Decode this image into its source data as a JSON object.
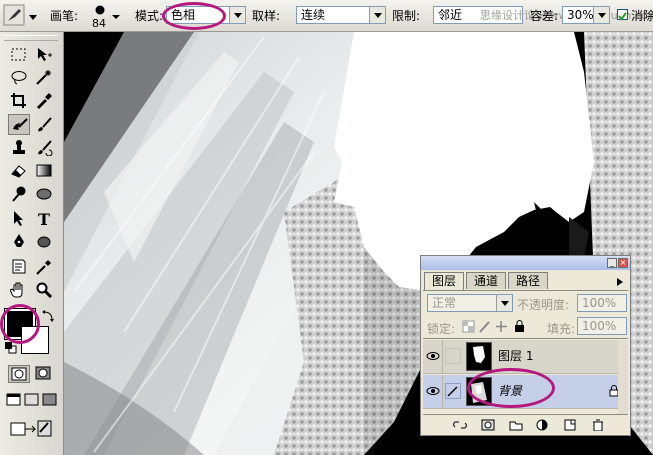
{
  "options_bar": {
    "brush_label": "画笔:",
    "brush_size": "84",
    "mode_label": "模式:",
    "mode_value": "色相",
    "sampling_label": "取样:",
    "sampling_value": "连续",
    "limits_label": "限制:",
    "limits_value": "邻近",
    "overlap_text": "思缘设计论坛  www.missyuan.com",
    "tolerance_label": "容差:",
    "tolerance_value": "30%",
    "antialias_label": "消除"
  },
  "toolbox": {
    "tools": [
      "marquee",
      "move",
      "lasso",
      "magic-wand",
      "crop",
      "slice",
      "healing",
      "brush",
      "stamp",
      "history-brush",
      "eraser",
      "gradient",
      "dodge",
      "blur",
      "path-select",
      "type",
      "pen",
      "shape",
      "notes",
      "eyedropper",
      "hand",
      "zoom"
    ],
    "foreground_color": "#000000",
    "background_color": "#ffffff"
  },
  "layers_panel": {
    "tabs": [
      "图层",
      "通道",
      "路径"
    ],
    "active_tab": "图层",
    "blend_mode": "正常",
    "opacity_label": "不透明度:",
    "opacity_value": "100%",
    "lock_label": "锁定:",
    "fill_label": "填充:",
    "fill_value": "100%",
    "layers": [
      {
        "name": "图层 1",
        "selected": false
      },
      {
        "name": "背景",
        "selected": true
      }
    ]
  },
  "annotation_color": "#b5177f"
}
